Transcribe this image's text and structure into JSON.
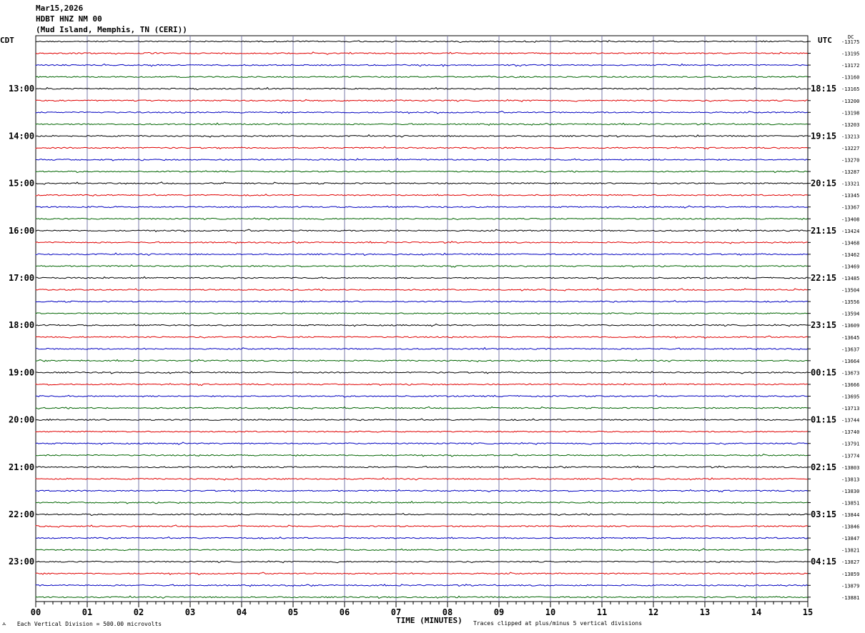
{
  "header": {
    "date": "Mar15,2026",
    "station": "HDBT HNZ NM 00",
    "location": "(Mud Island, Memphis, TN (CERI))"
  },
  "left_tz": "CDT",
  "right_tz": "UTC",
  "dc_label": "DC",
  "footer": {
    "scale_note": "Each Vertical Division =  500.00 microvolts",
    "clip_note": "Traces clipped at plus/minus 5 vertical divisions"
  },
  "chart_data": {
    "type": "line",
    "title": "HDBT HNZ NM 00",
    "xlabel": "TIME (MINUTES)",
    "x_ticks": [
      "00",
      "01",
      "02",
      "03",
      "04",
      "05",
      "06",
      "07",
      "08",
      "09",
      "10",
      "11",
      "12",
      "13",
      "14",
      "15"
    ],
    "xlim": [
      0,
      15
    ],
    "grid": true,
    "trace_colors": [
      "#000000",
      "#e00000",
      "#0000c0",
      "#006400"
    ],
    "left_hour_labels": [
      "13:00",
      "14:00",
      "15:00",
      "16:00",
      "17:00",
      "18:00",
      "19:00",
      "20:00",
      "21:00",
      "22:00",
      "23:00"
    ],
    "right_hour_labels": [
      "18:15",
      "19:15",
      "20:15",
      "21:15",
      "22:15",
      "23:15",
      "00:15",
      "01:15",
      "02:15",
      "03:15",
      "04:15"
    ],
    "dc_offsets": [
      "-13175",
      "-13195",
      "-13172",
      "-13160",
      "-13165",
      "-13200",
      "-13198",
      "-13203",
      "-13213",
      "-13227",
      "-13270",
      "-13287",
      "-13321",
      "-13345",
      "-13367",
      "-13408",
      "-13424",
      "-13468",
      "-13462",
      "-13469",
      "-13485",
      "-13504",
      "-13556",
      "-13594",
      "-13609",
      "-13645",
      "-13637",
      "-13664",
      "-13673",
      "-13666",
      "-13695",
      "-13713",
      "-13744",
      "-13740",
      "-13791",
      "-13774",
      "-13803",
      "-13813",
      "-13830",
      "-13851",
      "-13844",
      "-13846",
      "-13847",
      "-13821",
      "-13827",
      "-13859",
      "-13879",
      "-13881"
    ]
  }
}
